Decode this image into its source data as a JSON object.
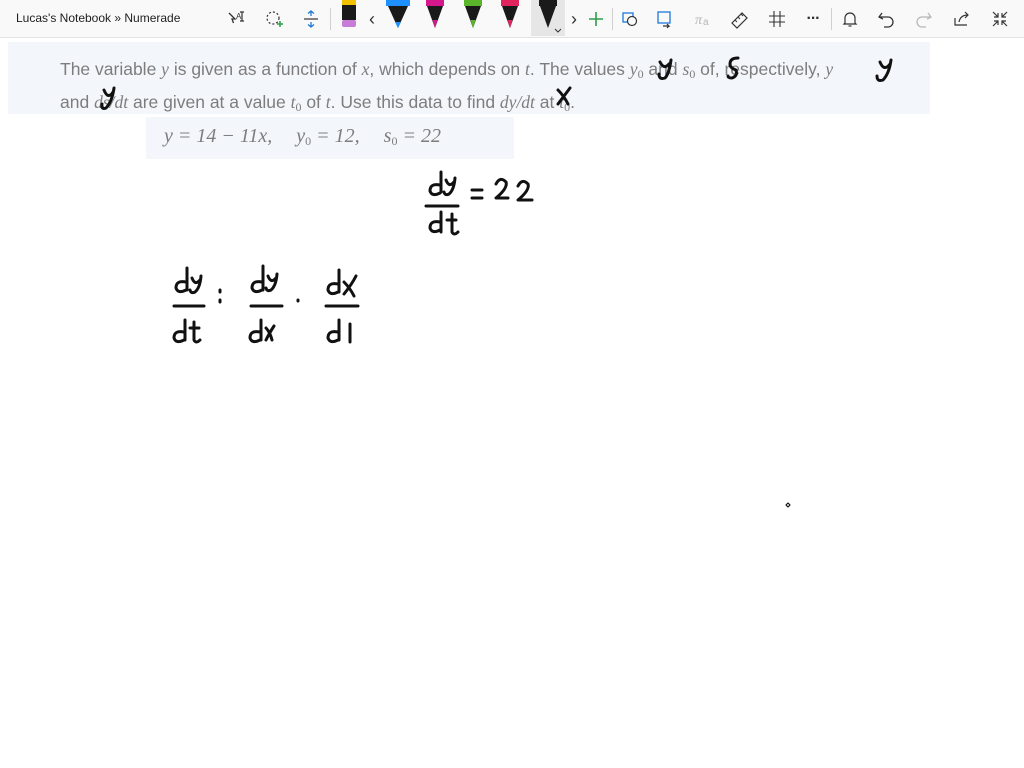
{
  "window": {
    "title": "Lucas's Notebook » Numerade"
  },
  "toolbar": {
    "tools": [
      {
        "name": "text-select-icon"
      },
      {
        "name": "lasso-select-icon"
      },
      {
        "name": "add-space-icon"
      },
      {
        "name": "scroll-left-icon",
        "glyph": "‹"
      },
      {
        "name": "scroll-right-icon",
        "glyph": "›"
      },
      {
        "name": "add-pen-icon"
      },
      {
        "name": "shapes-icon"
      },
      {
        "name": "ink-to-shape-icon"
      },
      {
        "name": "ink-to-math-icon"
      },
      {
        "name": "ruler-icon"
      },
      {
        "name": "grid-icon"
      },
      {
        "name": "more-icon",
        "glyph": "···"
      },
      {
        "name": "bell-icon"
      },
      {
        "name": "undo-icon"
      },
      {
        "name": "redo-icon"
      },
      {
        "name": "share-icon"
      },
      {
        "name": "collapse-icon"
      }
    ],
    "pens": [
      {
        "name": "pen-black-purple",
        "color": "#1a1a1a",
        "accent": "#c77dd8"
      },
      {
        "name": "pen-blue",
        "color": "#1e90ff"
      },
      {
        "name": "pen-magenta",
        "color": "#d4188c"
      },
      {
        "name": "pen-green",
        "color": "#5ab52a"
      },
      {
        "name": "pen-pink",
        "color": "#e0245e"
      },
      {
        "name": "pen-black",
        "color": "#1a1a1a",
        "selected": true
      }
    ]
  },
  "problem": {
    "p1": "The variable ",
    "var_y": "y",
    "p2": " is given as a function of ",
    "var_x": "x",
    "p3": ", which depends on ",
    "var_t": "t",
    "p4": ". The values ",
    "y0_base": "y",
    "y0_sub": "0",
    "p5": " and ",
    "s0_base": "s",
    "s0_sub": "0",
    "p6": " of, respectively, ",
    "p6b": "y",
    "p7": " and ",
    "dsdt": "ds/dt",
    "p8": " are given at a value ",
    "t0_base": "t",
    "t0_sub": "0",
    "p9": " of ",
    "p10": "t",
    "p11": ". Use this data to find ",
    "dydt": "dy/dt",
    "p12": " at ",
    "t0b_base": "t",
    "t0b_sub": "0",
    "p13": "."
  },
  "given": {
    "eq1": "y = 14 − 11x,",
    "eq2_base": "y",
    "eq2_sub": "0",
    "eq2_rest": " = 12,",
    "eq3_base": "s",
    "eq3_sub": "0",
    "eq3_rest": " = 22"
  },
  "ink_color": "#111111"
}
